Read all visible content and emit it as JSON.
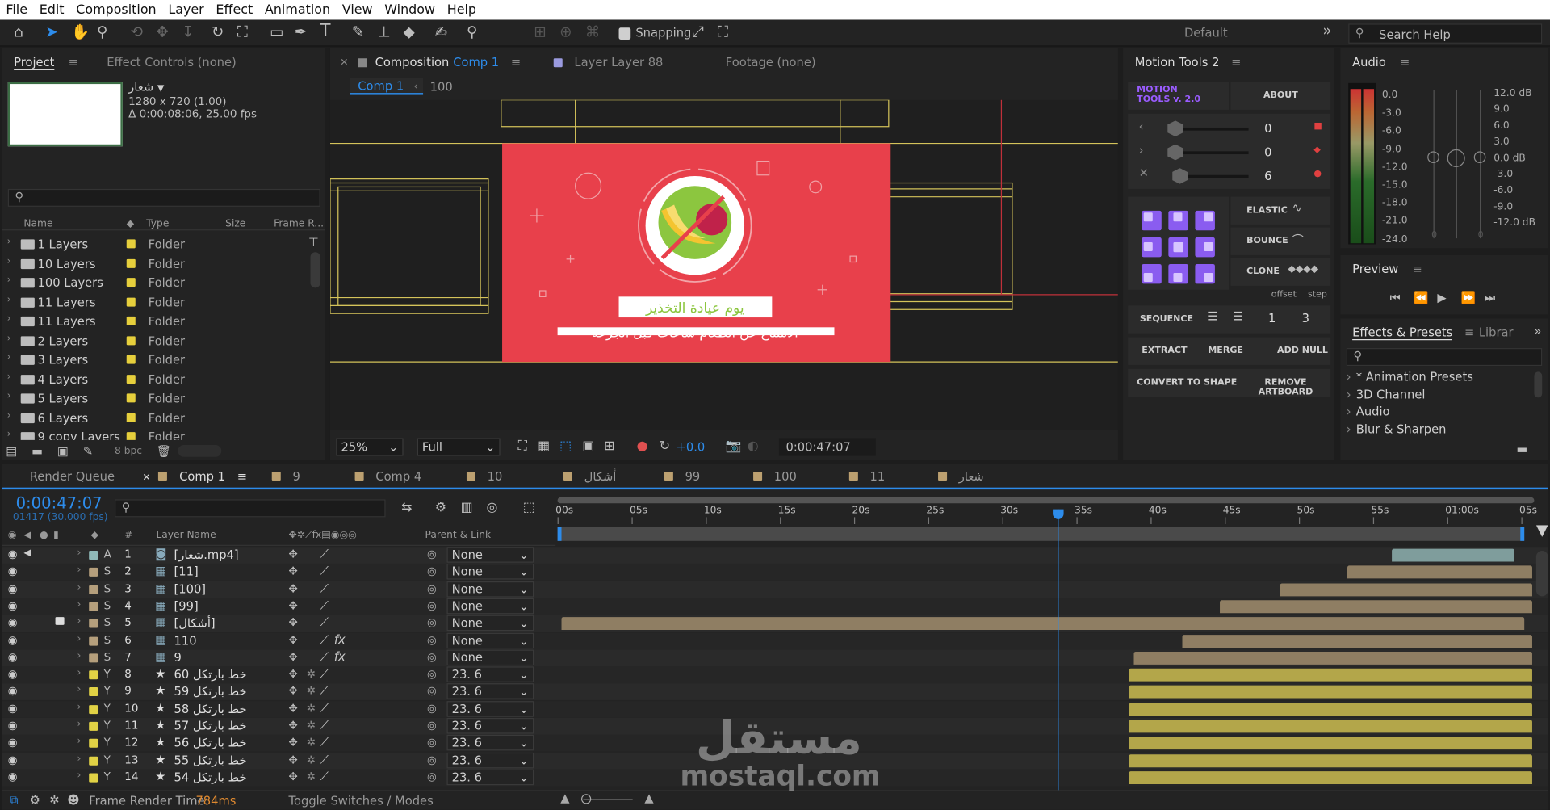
{
  "menu": [
    "File",
    "Edit",
    "Composition",
    "Layer",
    "Effect",
    "Animation",
    "View",
    "Window",
    "Help"
  ],
  "toolbar": {
    "snapping": "Snapping",
    "workspace": "Default",
    "search_placeholder": "Search Help"
  },
  "project": {
    "tab": "Project",
    "effect_controls": "Effect Controls (none)",
    "item_name": "شعار",
    "item_dims": "1280 x 720 (1.00)",
    "item_duration": "Δ 0:00:08:06, 25.00 fps",
    "columns": {
      "name": "Name",
      "type": "Type",
      "size": "Size",
      "frame": "Frame R..."
    },
    "rows": [
      {
        "name": "1 Layers",
        "type": "Folder"
      },
      {
        "name": "10 Layers",
        "type": "Folder"
      },
      {
        "name": "100 Layers",
        "type": "Folder"
      },
      {
        "name": "11 Layers",
        "type": "Folder"
      },
      {
        "name": "11 Layers",
        "type": "Folder"
      },
      {
        "name": "2 Layers",
        "type": "Folder"
      },
      {
        "name": "3 Layers",
        "type": "Folder"
      },
      {
        "name": "4 Layers",
        "type": "Folder"
      },
      {
        "name": "5 Layers",
        "type": "Folder"
      },
      {
        "name": "6 Layers",
        "type": "Folder"
      },
      {
        "name": "9 copy Layers",
        "type": "Folder"
      }
    ],
    "bpc": "8 bpc"
  },
  "viewer": {
    "tab_label": "Composition",
    "tab_comp": "Comp 1",
    "layer_tab": "Layer  Layer 88",
    "footage_tab": "Footage  (none)",
    "crumb": "Comp 1",
    "crumb_num": "100",
    "art_title": "يوم عيادة التخذير",
    "art_sub": "الامتناع عن الطعام ساعات قبل الجرعة",
    "zoom": "25%",
    "quality": "Full",
    "exposure": "+0.0",
    "timecode": "0:00:47:07"
  },
  "motion_tools": {
    "title": "Motion Tools 2",
    "logo1": "MOTION",
    "logo2": "TOOLS v. 2.0",
    "about": "ABOUT",
    "sliders": [
      {
        "value": "0",
        "pos": 0.0
      },
      {
        "value": "0",
        "pos": 0.0
      },
      {
        "value": "6",
        "pos": 0.06
      }
    ],
    "elastic": "ELASTIC",
    "bounce": "BOUNCE",
    "clone": "CLONE",
    "offset": "offset",
    "step": "step",
    "sequence": "SEQUENCE",
    "seq_a": "1",
    "seq_b": "3",
    "extract": "EXTRACT",
    "merge": "MERGE",
    "add_null": "ADD NULL",
    "convert": "CONVERT TO SHAPE",
    "remove_artboard": "REMOVE ARTBOARD",
    "accent": "#9a5cff"
  },
  "audio": {
    "title": "Audio",
    "left_scale": [
      "0.0",
      "-3.0",
      "-6.0",
      "-9.0",
      "-12.0",
      "-15.0",
      "-18.0",
      "-21.0",
      "-24.0"
    ],
    "right_scale": [
      "12.0 dB",
      "9.0",
      "6.0",
      "3.0",
      "0.0 dB",
      "-3.0",
      "-6.0",
      "-9.0",
      "-12.0 dB"
    ],
    "zero_l": "0",
    "zero_r": "0"
  },
  "preview": {
    "title": "Preview"
  },
  "effects": {
    "title": "Effects & Presets",
    "library": "Librar",
    "items": [
      "* Animation Presets",
      "3D Channel",
      "Audio",
      "Blur & Sharpen"
    ]
  },
  "timeline": {
    "tabs": [
      {
        "label": "Render Queue"
      },
      {
        "label": "Comp 1"
      },
      {
        "label": "9"
      },
      {
        "label": "Comp 4"
      },
      {
        "label": "10"
      },
      {
        "label": "أشكال"
      },
      {
        "label": "99"
      },
      {
        "label": "100"
      },
      {
        "label": "11"
      },
      {
        "label": "شعار"
      }
    ],
    "timecode": "0:00:47:07",
    "fps": "01417 (30.000 fps)",
    "col_layer": "Layer Name",
    "col_parent": "Parent & Link",
    "ruler": [
      "00s",
      "05s",
      "10s",
      "15s",
      "20s",
      "25s",
      "30s",
      "35s",
      "40s",
      "45s",
      "50s",
      "55s",
      "01:00s",
      "05s"
    ],
    "playhead": 0.47,
    "layers": [
      {
        "num": "1",
        "letter": "A",
        "name": "[شعار.mp4]",
        "parent": "None",
        "icon": "video",
        "fx": false,
        "color": "#8fb9b8",
        "start": 0.855,
        "end": 0.982,
        "bar": "#7f9d9c"
      },
      {
        "num": "2",
        "letter": "S",
        "name": "[11]",
        "parent": "None",
        "icon": "comp",
        "fx": false,
        "color": "#b59f7c",
        "start": 0.81,
        "end": 1.0,
        "bar": "#8f7e63"
      },
      {
        "num": "3",
        "letter": "S",
        "name": "[100]",
        "parent": "None",
        "icon": "comp",
        "fx": false,
        "color": "#b59f7c",
        "start": 0.74,
        "end": 1.0,
        "bar": "#8f7e63"
      },
      {
        "num": "4",
        "letter": "S",
        "name": "[99]",
        "parent": "None",
        "icon": "comp",
        "fx": false,
        "color": "#b59f7c",
        "start": 0.678,
        "end": 1.0,
        "bar": "#8f7e63"
      },
      {
        "num": "5",
        "letter": "S",
        "name": "[أشكال]",
        "parent": "None",
        "icon": "comp",
        "fx": false,
        "color": "#b59f7c",
        "start": 0.0,
        "end": 0.992,
        "bar": "#8f7e63",
        "locked": true
      },
      {
        "num": "6",
        "letter": "S",
        "name": "110",
        "parent": "None",
        "icon": "comp",
        "fx": true,
        "color": "#b59f7c",
        "start": 0.64,
        "end": 1.0,
        "bar": "#8f7e63"
      },
      {
        "num": "7",
        "letter": "S",
        "name": "9",
        "parent": "None",
        "icon": "comp",
        "fx": true,
        "color": "#b59f7c",
        "start": 0.59,
        "end": 1.0,
        "bar": "#8f7e63"
      },
      {
        "num": "8",
        "letter": "Y",
        "name": "خط بارتكل 60",
        "parent": "23. 6",
        "icon": "star",
        "fx": false,
        "color": "#e1d245",
        "start": 0.585,
        "end": 1.0,
        "bar": "#b3a64a"
      },
      {
        "num": "9",
        "letter": "Y",
        "name": "خط بارتكل 59",
        "parent": "23. 6",
        "icon": "star",
        "fx": false,
        "color": "#e1d245",
        "start": 0.585,
        "end": 1.0,
        "bar": "#b3a64a"
      },
      {
        "num": "10",
        "letter": "Y",
        "name": "خط بارتكل 58",
        "parent": "23. 6",
        "icon": "star",
        "fx": false,
        "color": "#e1d245",
        "start": 0.585,
        "end": 1.0,
        "bar": "#b3a64a"
      },
      {
        "num": "11",
        "letter": "Y",
        "name": "خط بارتكل 57",
        "parent": "23. 6",
        "icon": "star",
        "fx": false,
        "color": "#e1d245",
        "start": 0.585,
        "end": 1.0,
        "bar": "#b3a64a"
      },
      {
        "num": "12",
        "letter": "Y",
        "name": "خط بارتكل 56",
        "parent": "23. 6",
        "icon": "star",
        "fx": false,
        "color": "#e1d245",
        "start": 0.585,
        "end": 1.0,
        "bar": "#b3a64a"
      },
      {
        "num": "13",
        "letter": "Y",
        "name": "خط بارتكل 55",
        "parent": "23. 6",
        "icon": "star",
        "fx": false,
        "color": "#e1d245",
        "start": 0.585,
        "end": 1.0,
        "bar": "#b3a64a"
      },
      {
        "num": "14",
        "letter": "Y",
        "name": "خط بارتكل 54",
        "parent": "23. 6",
        "icon": "star",
        "fx": false,
        "color": "#e1d245",
        "start": 0.585,
        "end": 1.0,
        "bar": "#b3a64a"
      }
    ],
    "footer_render": "Frame Render Time:",
    "footer_ms": "784ms",
    "footer_toggle": "Toggle Switches / Modes"
  },
  "watermark": {
    "ar": "مستقل",
    "en": "mostaql.com"
  },
  "colors": {
    "accent_blue": "#2d8ceb",
    "art_red": "#e8404b",
    "guide_yellow": "#d4c35a"
  }
}
